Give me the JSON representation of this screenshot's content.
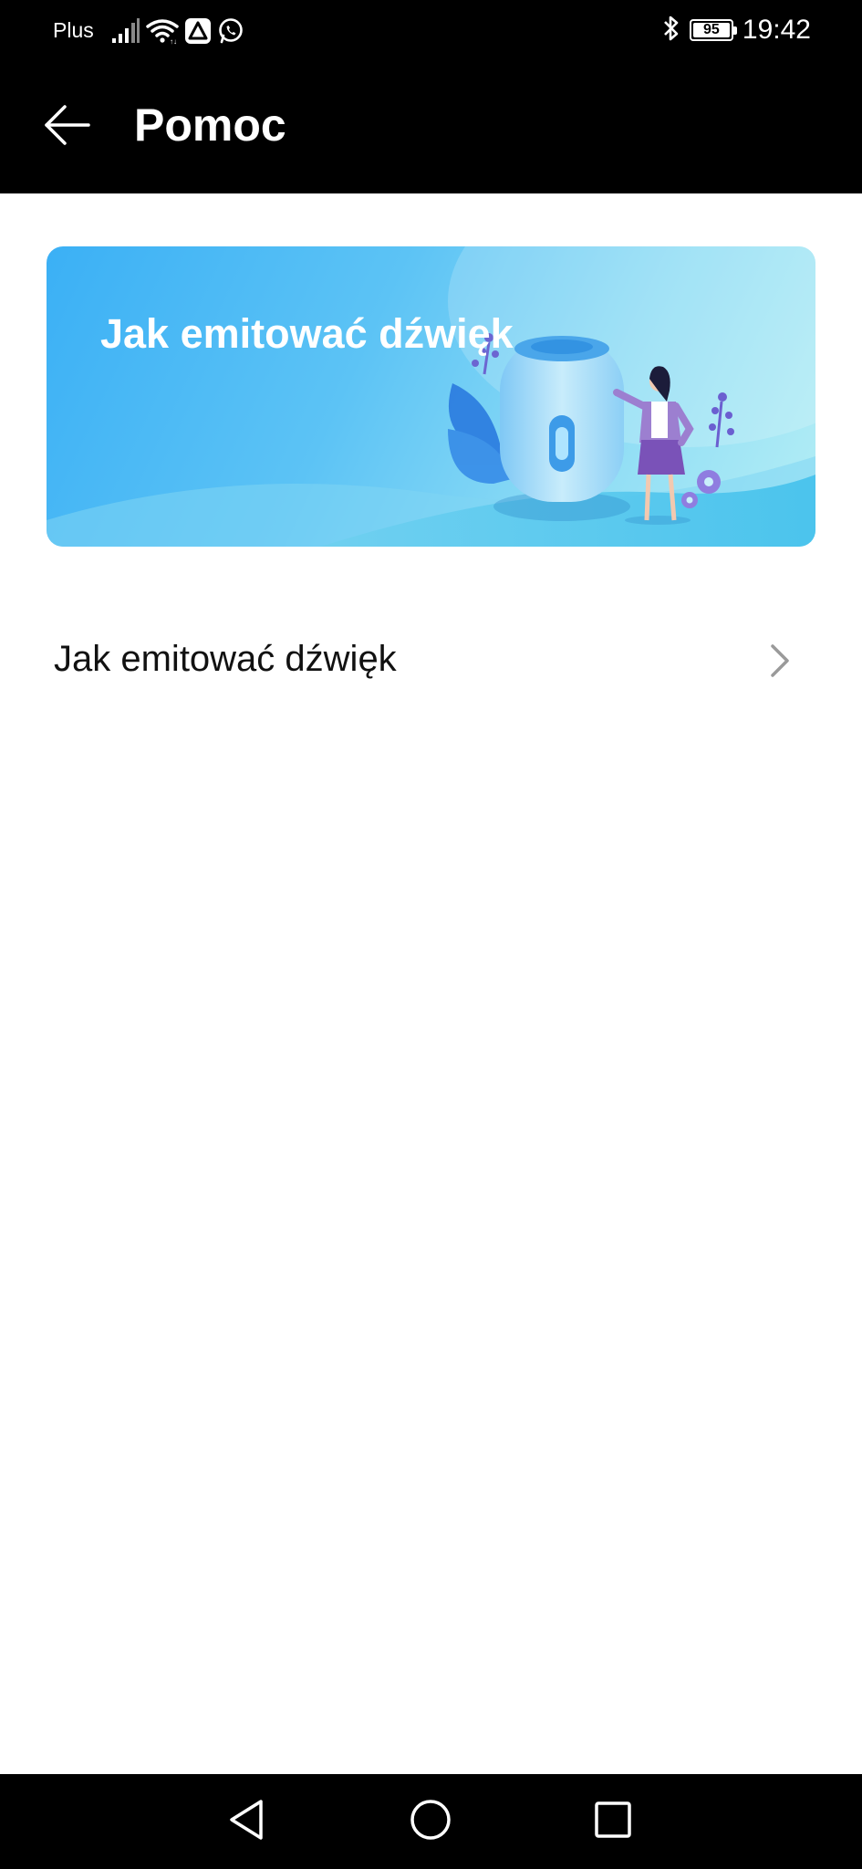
{
  "status_bar": {
    "carrier": "Plus",
    "battery_level": "95",
    "time": "19:42",
    "icons": [
      "signal-icon",
      "wifi-icon",
      "app-notification-icon",
      "whatsapp-icon",
      "bluetooth-icon",
      "battery-icon"
    ]
  },
  "header": {
    "title": "Pomoc",
    "back_icon": "arrow-left-icon"
  },
  "banner": {
    "title": "Jak emitować dźwięk",
    "illustration": "smart-speaker-with-woman-illustration"
  },
  "list": {
    "items": [
      {
        "label": "Jak emitować dźwięk",
        "icon": "chevron-right-icon"
      }
    ]
  },
  "nav_bar": {
    "buttons": [
      "back-triangle-icon",
      "home-circle-icon",
      "recents-square-icon"
    ]
  },
  "colors": {
    "bars": "#000000",
    "background": "#ffffff",
    "banner_start": "#3bb0f5",
    "banner_end": "#b4eef5",
    "text_primary": "#111111",
    "chevron": "#9a9a9a"
  }
}
